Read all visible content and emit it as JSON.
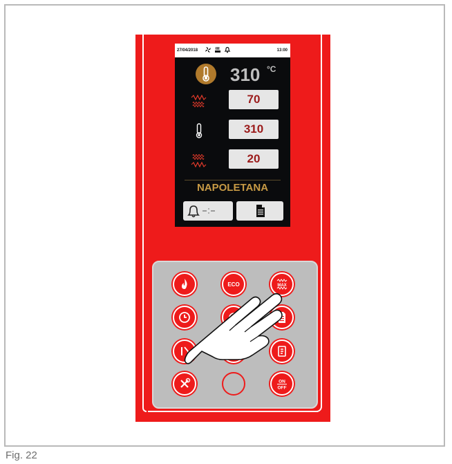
{
  "screen": {
    "status_bar": {
      "date": "27/04/2018",
      "time": "13:00",
      "icons": [
        "fan-icon",
        "steam-icon",
        "bell-icon"
      ]
    },
    "main_temperature": {
      "value": "310",
      "unit": "°C",
      "icon": "thermometer-icon"
    },
    "rows": [
      {
        "icon": "top-heater-icon",
        "value": "70"
      },
      {
        "icon": "thermometer-icon",
        "value": "310"
      },
      {
        "icon": "bottom-heater-icon",
        "value": "20"
      }
    ],
    "recipe_name": "NAPOLETANA",
    "bottom_buttons": [
      {
        "icon": "bell-icon",
        "secondary_icon": "dashes-icon"
      },
      {
        "icon": "document-icon"
      }
    ]
  },
  "keypad": {
    "keys": [
      {
        "name": "flame-key",
        "label": ""
      },
      {
        "name": "eco-key",
        "label": "ECO"
      },
      {
        "name": "max-key",
        "label": "MAX"
      },
      {
        "name": "clock-key",
        "label": ""
      },
      {
        "name": "program-key",
        "label": ""
      },
      {
        "name": "recipe-key",
        "label": ""
      },
      {
        "name": "door-key",
        "label": ""
      },
      {
        "name": "light-key",
        "label": ""
      },
      {
        "name": "recipe-book-key",
        "label": ""
      },
      {
        "name": "tools-key",
        "label": ""
      },
      {
        "name": "blank-key",
        "label": ""
      },
      {
        "name": "power-key",
        "label_on": "ON",
        "label_off": "OFF"
      }
    ]
  },
  "caption": "Fig. 22",
  "colors": {
    "panel": "#ee1b1b",
    "screen": "#0a0b0d",
    "accent_gold": "#c79a45",
    "value_red": "#9b1b1b"
  }
}
